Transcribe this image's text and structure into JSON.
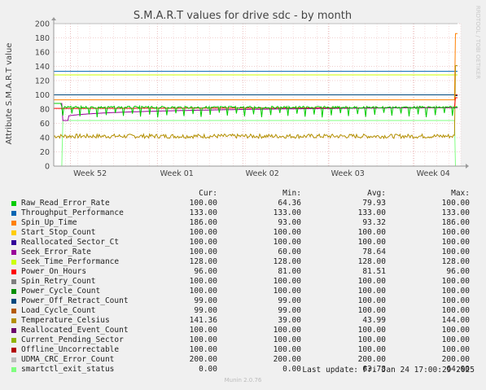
{
  "chart_data": {
    "type": "line",
    "title": "S.M.A.R.T values for drive sdc - by month",
    "ylabel": "Attribute S.M.A.R.T value",
    "watermark": "RRDTOOL / TOBI OETIKER",
    "ylim": [
      0,
      200
    ],
    "y_ticks": [
      "0",
      "20",
      "40",
      "60",
      "80",
      "100",
      "120",
      "140",
      "160",
      "180",
      "200"
    ],
    "x_ticks": [
      "Week 52",
      "Week 01",
      "Week 02",
      "Week 03",
      "Week 04"
    ],
    "grid": true,
    "columns": [
      "Cur:",
      "Min:",
      "Avg:",
      "Max:"
    ],
    "series": [
      {
        "name": "Raw_Read_Error_Rate",
        "color": "#00cc00",
        "cur": "100.00",
        "min": "64.36",
        "avg": "79.93",
        "max": "100.00"
      },
      {
        "name": "Throughput_Performance",
        "color": "#0066b3",
        "cur": "133.00",
        "min": "133.00",
        "avg": "133.00",
        "max": "133.00"
      },
      {
        "name": "Spin_Up_Time",
        "color": "#ff8000",
        "cur": "186.00",
        "min": "93.00",
        "avg": "93.32",
        "max": "186.00"
      },
      {
        "name": "Start_Stop_Count",
        "color": "#ffcc00",
        "cur": "100.00",
        "min": "100.00",
        "avg": "100.00",
        "max": "100.00"
      },
      {
        "name": "Reallocated_Sector_Ct",
        "color": "#330099",
        "cur": "100.00",
        "min": "100.00",
        "avg": "100.00",
        "max": "100.00"
      },
      {
        "name": "Seek_Error_Rate",
        "color": "#990099",
        "cur": "100.00",
        "min": "60.00",
        "avg": "78.64",
        "max": "100.00"
      },
      {
        "name": "Seek_Time_Performance",
        "color": "#ccff00",
        "cur": "128.00",
        "min": "128.00",
        "avg": "128.00",
        "max": "128.00"
      },
      {
        "name": "Power_On_Hours",
        "color": "#ff0000",
        "cur": "96.00",
        "min": "81.00",
        "avg": "81.51",
        "max": "96.00"
      },
      {
        "name": "Spin_Retry_Count",
        "color": "#808080",
        "cur": "100.00",
        "min": "100.00",
        "avg": "100.00",
        "max": "100.00"
      },
      {
        "name": "Power_Cycle_Count",
        "color": "#008f00",
        "cur": "100.00",
        "min": "100.00",
        "avg": "100.00",
        "max": "100.00"
      },
      {
        "name": "Power_Off_Retract_Count",
        "color": "#00487d",
        "cur": "99.00",
        "min": "99.00",
        "avg": "100.00",
        "max": "100.00"
      },
      {
        "name": "Load_Cycle_Count",
        "color": "#b35a00",
        "cur": "99.00",
        "min": "99.00",
        "avg": "100.00",
        "max": "100.00"
      },
      {
        "name": "Temperature_Celsius",
        "color": "#b38f00",
        "cur": "141.36",
        "min": "39.00",
        "avg": "43.99",
        "max": "144.00"
      },
      {
        "name": "Reallocated_Event_Count",
        "color": "#6b006b",
        "cur": "100.00",
        "min": "100.00",
        "avg": "100.00",
        "max": "100.00"
      },
      {
        "name": "Current_Pending_Sector",
        "color": "#8fb300",
        "cur": "100.00",
        "min": "100.00",
        "avg": "100.00",
        "max": "100.00"
      },
      {
        "name": "Offline_Uncorrectable",
        "color": "#b30000",
        "cur": "100.00",
        "min": "100.00",
        "avg": "100.00",
        "max": "100.00"
      },
      {
        "name": "UDMA_CRC_Error_Count",
        "color": "#bebebe",
        "cur": "200.00",
        "min": "200.00",
        "avg": "200.00",
        "max": "200.00"
      },
      {
        "name": "smartctl_exit_status",
        "color": "#80ff80",
        "cur": "0.00",
        "min": "0.00",
        "avg": "63.78",
        "max": "64.00"
      }
    ]
  },
  "last_update": "Last update: Fri Jan 24 17:00:29 2025",
  "footer": "Munin 2.0.76"
}
